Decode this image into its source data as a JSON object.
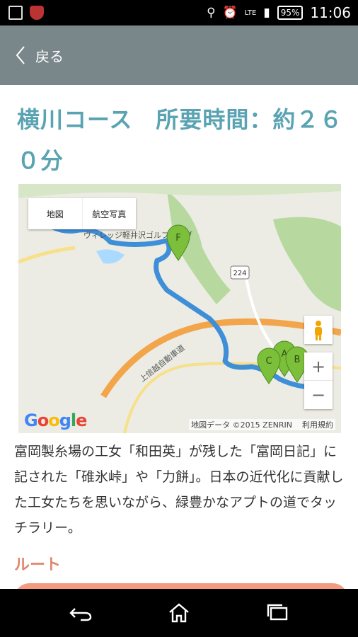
{
  "status_bar": {
    "network_label": "LTE",
    "battery": "95%",
    "time": "11:06"
  },
  "header": {
    "back_label": "戻る"
  },
  "page": {
    "title": "横川コース　所要時間：約２６０分"
  },
  "map": {
    "type_options": [
      "地図",
      "航空写真"
    ],
    "zoom_in": "+",
    "zoom_out": "−",
    "road_number": "224",
    "highway_label": "上信越自動車道",
    "place_label": "ヴィレッジ軽井沢ゴルフクラブ",
    "route_markers": [
      "A",
      "B",
      "C",
      "F"
    ],
    "attribution": "地図データ ©2015 ZENRIN",
    "terms": "利用規約",
    "google_logo": [
      "G",
      "o",
      "o",
      "g",
      "l",
      "e"
    ],
    "colors": {
      "route": "#3f8fd8",
      "marker": "#7cbf3a",
      "highway": "#f2a54a",
      "forest": "#b7d9a0"
    }
  },
  "description": "富岡製糸場の工女「和田英」が残した「富岡日記」に記された「碓氷峠」や「力餅」。日本の近代化に貢献した工女たちを思いながら、緑豊かなアプトの道でタッチラリー。",
  "route": {
    "heading": "ルート"
  },
  "theme": {
    "appbar": "#79868a",
    "title": "#5aa3b2",
    "accent": "#e1876e"
  }
}
